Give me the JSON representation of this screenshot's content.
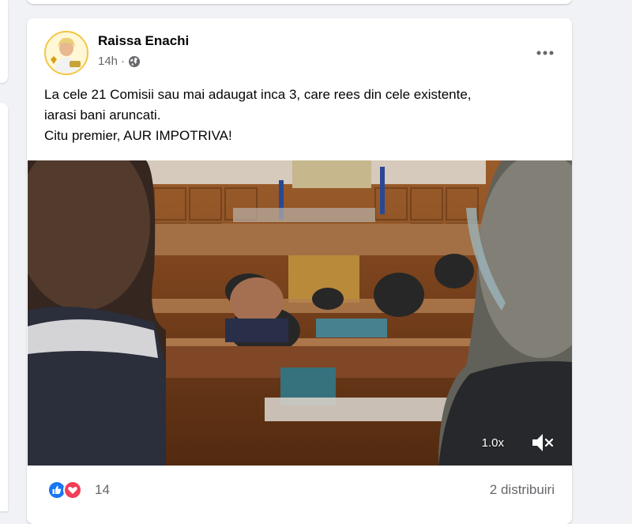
{
  "post": {
    "author": "Raissa Enachi",
    "time": "14h",
    "privacy_icon": "globe-icon",
    "more_icon": "more-options-icon",
    "text_lines": [
      "La cele 21 Comisii sau mai adaugat inca 3, care rees din cele existente,",
      "iarasi bani aruncati.",
      "Citu premier, AUR IMPOTRIVA!"
    ],
    "video": {
      "speed": "1.0x",
      "mute_icon": "volume-muted-icon"
    },
    "reactions": {
      "icons": [
        "like-icon",
        "love-icon"
      ],
      "count": "14"
    },
    "shares": "2 distribuiri"
  },
  "colors": {
    "like_blue": "#1877f2",
    "love_red": "#f33e58",
    "secondary_text": "#65676b"
  }
}
